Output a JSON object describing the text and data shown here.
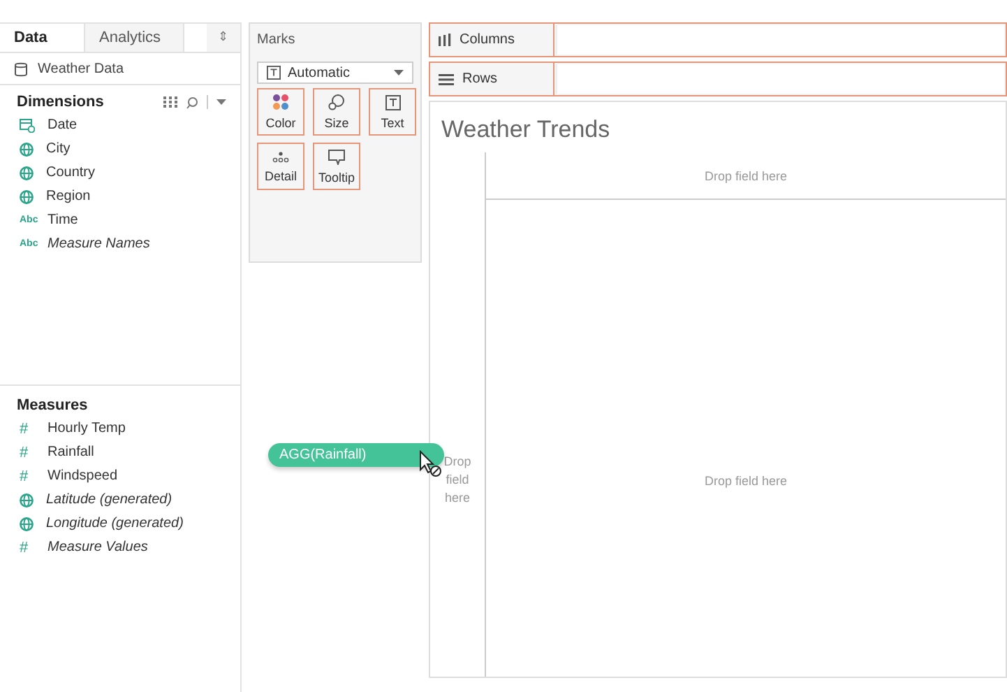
{
  "tabs": [
    {
      "label": "Data",
      "selected": true
    },
    {
      "label": "Analytics",
      "selected": false
    }
  ],
  "tabs_arrow": "⇕",
  "data_source": "Weather Data",
  "dimensions": {
    "title": "Dimensions",
    "items": [
      {
        "kind": "date",
        "label": "Date",
        "generated": false
      },
      {
        "kind": "geo",
        "label": "City",
        "generated": false
      },
      {
        "kind": "geo",
        "label": "Country",
        "generated": false
      },
      {
        "kind": "geo",
        "label": "Region",
        "generated": false
      },
      {
        "kind": "text",
        "label": "Time",
        "type_label": "Abc",
        "generated": false
      },
      {
        "kind": "text",
        "label": "Measure Names",
        "type_label": "Abc",
        "generated": true
      }
    ]
  },
  "measures": {
    "title": "Measures",
    "items": [
      {
        "kind": "number",
        "label": "Hourly Temp",
        "type_label": "#",
        "generated": false
      },
      {
        "kind": "number",
        "label": "Rainfall",
        "type_label": "#",
        "generated": false
      },
      {
        "kind": "number",
        "label": "Windspeed",
        "type_label": "#",
        "generated": false
      },
      {
        "kind": "geo",
        "label": "Latitude (generated)",
        "generated": true
      },
      {
        "kind": "geo",
        "label": "Longitude (generated)",
        "generated": true
      },
      {
        "kind": "number",
        "label": "Measure Values",
        "type_label": "#",
        "generated": true
      }
    ]
  },
  "marks": {
    "title": "Marks",
    "mark_type": "Automatic",
    "cards": [
      {
        "kind": "color",
        "label": "Color"
      },
      {
        "kind": "size",
        "label": "Size"
      },
      {
        "kind": "text",
        "label": "Text"
      },
      {
        "kind": "detail",
        "label": "Detail"
      },
      {
        "kind": "tooltip",
        "label": "Tooltip"
      }
    ]
  },
  "shelves": [
    {
      "kind": "columns",
      "label": "Columns"
    },
    {
      "kind": "rows",
      "label": "Rows"
    }
  ],
  "view": {
    "title": "Weather Trends",
    "drop_top": "Drop field here",
    "drop_left": "Drop field here",
    "drop_center": "Drop field here"
  },
  "dragged_pill": "AGG(Rainfall)"
}
